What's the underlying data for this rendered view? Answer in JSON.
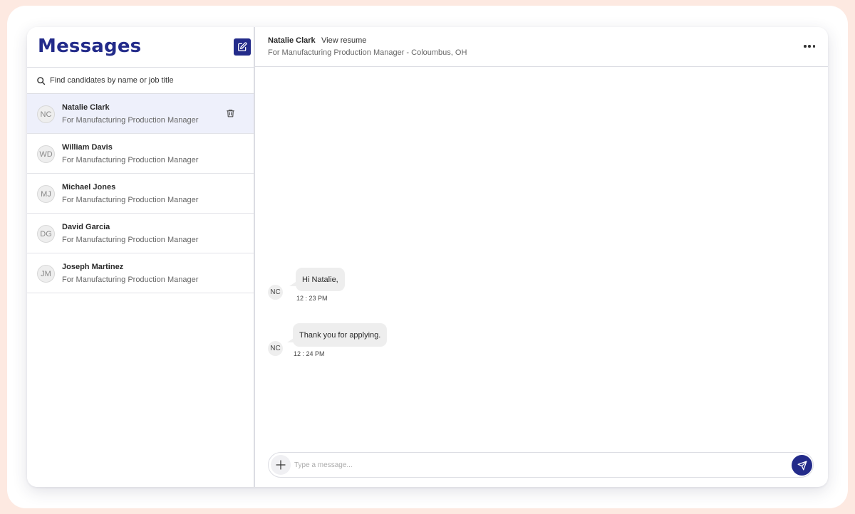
{
  "colors": {
    "accent": "#232b8a",
    "page_bg": "#fde9e1",
    "active_row": "#eef0fb",
    "bubble": "#eeeeee"
  },
  "sidebar": {
    "title": "Messages",
    "compose_icon": "edit-icon",
    "search": {
      "placeholder": "Find candidates by name or job title",
      "icon": "search-icon"
    },
    "conversations": [
      {
        "initials": "NC",
        "name": "Natalie Clark",
        "subtitle": "For Manufacturing Production Manager",
        "active": true
      },
      {
        "initials": "WD",
        "name": "William Davis",
        "subtitle": "For Manufacturing Production Manager",
        "active": false
      },
      {
        "initials": "MJ",
        "name": "Michael Jones",
        "subtitle": "For Manufacturing Production Manager",
        "active": false
      },
      {
        "initials": "DG",
        "name": "David Garcia",
        "subtitle": "For Manufacturing Production Manager",
        "active": false
      },
      {
        "initials": "JM",
        "name": "Joseph Martinez",
        "subtitle": "For Manufacturing Production Manager",
        "active": false
      }
    ],
    "delete_icon": "trash-icon"
  },
  "chat": {
    "header": {
      "name": "Natalie Clark",
      "view_resume": "View resume",
      "job": "For Manufacturing Production Manager - Coloumbus, OH",
      "more_icon": "more-horizontal-icon"
    },
    "messages": [
      {
        "avatar": "NC",
        "text": "Hi Natalie,",
        "time": "12 : 23 PM"
      },
      {
        "avatar": "NC",
        "text": "Thank you for applying.",
        "time": "12 : 24 PM"
      }
    ],
    "composer": {
      "placeholder": "Type a message...",
      "add_icon": "plus-icon",
      "send_icon": "send-icon"
    }
  }
}
